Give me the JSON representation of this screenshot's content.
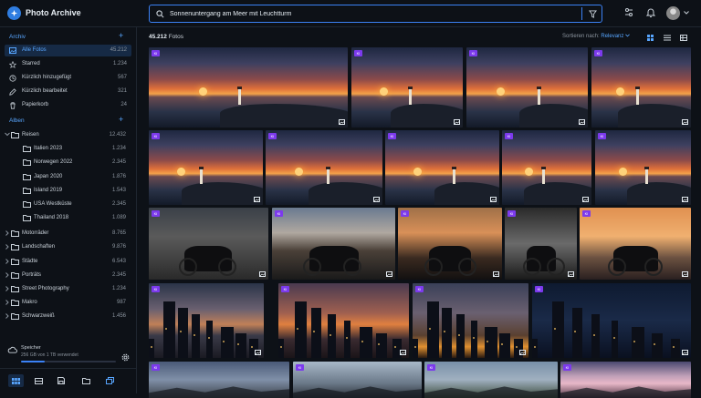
{
  "app": {
    "title": "Photo Archive"
  },
  "search": {
    "value": "Sonnenuntergang am Meer mit Leuchtturm",
    "placeholder": ""
  },
  "sidebar": {
    "archive_heading": "Archiv",
    "archive_items": [
      {
        "label": "Alle Fotos",
        "count": "45.212",
        "icon": "image-icon"
      },
      {
        "label": "Starred",
        "count": "1.234",
        "icon": "star-icon"
      },
      {
        "label": "Kürzlich hinzugefügt",
        "count": "567",
        "icon": "clock-icon"
      },
      {
        "label": "Kürzlich bearbeitet",
        "count": "321",
        "icon": "edit-icon"
      },
      {
        "label": "Papierkorb",
        "count": "24",
        "icon": "trash-icon"
      }
    ],
    "albums_heading": "Alben",
    "albums": [
      {
        "label": "Reisen",
        "count": "12.432",
        "level": 0,
        "expanded": true
      },
      {
        "label": "Italien 2023",
        "count": "1.234",
        "level": 1
      },
      {
        "label": "Norwegen 2022",
        "count": "2.345",
        "level": 1
      },
      {
        "label": "Japan 2020",
        "count": "1.876",
        "level": 1
      },
      {
        "label": "Island 2019",
        "count": "1.543",
        "level": 1
      },
      {
        "label": "USA Westküste",
        "count": "2.345",
        "level": 1
      },
      {
        "label": "Thailand 2018",
        "count": "1.089",
        "level": 1
      },
      {
        "label": "Motorräder",
        "count": "8.765",
        "level": 0
      },
      {
        "label": "Landschaften",
        "count": "9.876",
        "level": 0
      },
      {
        "label": "Städte",
        "count": "6.543",
        "level": 0
      },
      {
        "label": "Porträts",
        "count": "2.345",
        "level": 0
      },
      {
        "label": "Street Photography",
        "count": "1.234",
        "level": 0
      },
      {
        "label": "Makro",
        "count": "987",
        "level": 0
      },
      {
        "label": "Schwarzweiß",
        "count": "1.456",
        "level": 0
      }
    ],
    "storage": {
      "label": "Speicher",
      "detail": "256 GB von 1 TB verwendet",
      "used_fraction": 0.25
    }
  },
  "main": {
    "count_number": "45.212",
    "count_label": "Fotos",
    "sort_label": "Sortieren nach:",
    "sort_value": "Relevanz",
    "photo_tag": "KI"
  },
  "colors": {
    "accent": "#3b82f6",
    "tag": "#7c3aed",
    "bg": "#0d1117"
  }
}
